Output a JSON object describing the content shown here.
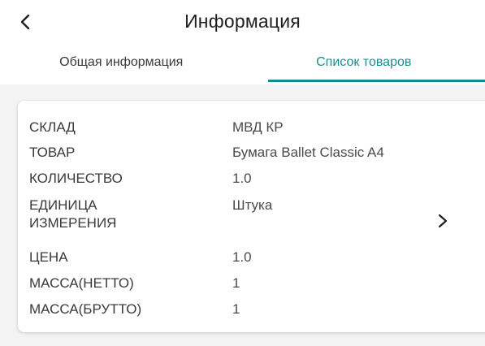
{
  "header": {
    "title": "Информация",
    "back_icon": "chevron-left-icon"
  },
  "tabs": [
    {
      "label": "Общая информация",
      "active": false
    },
    {
      "label": "Список товаров",
      "active": true
    }
  ],
  "accent_color": "#178a8e",
  "card": {
    "rows": [
      {
        "label": "СКЛАД",
        "value": "МВД КР"
      },
      {
        "label": "ТОВАР",
        "value": "Бумага Ballet Classic A4"
      },
      {
        "label": "КОЛИЧЕСТВО",
        "value": "1.0"
      },
      {
        "label": "ЕДИНИЦА ИЗМЕРЕНИЯ",
        "value": "Штука"
      },
      {
        "label": "ЦЕНА",
        "value": "1.0"
      },
      {
        "label": "МАССА(НЕТТО)",
        "value": "1"
      },
      {
        "label": "МАССА(БРУТТО)",
        "value": "1"
      }
    ],
    "chevron_icon": "chevron-right-icon"
  }
}
